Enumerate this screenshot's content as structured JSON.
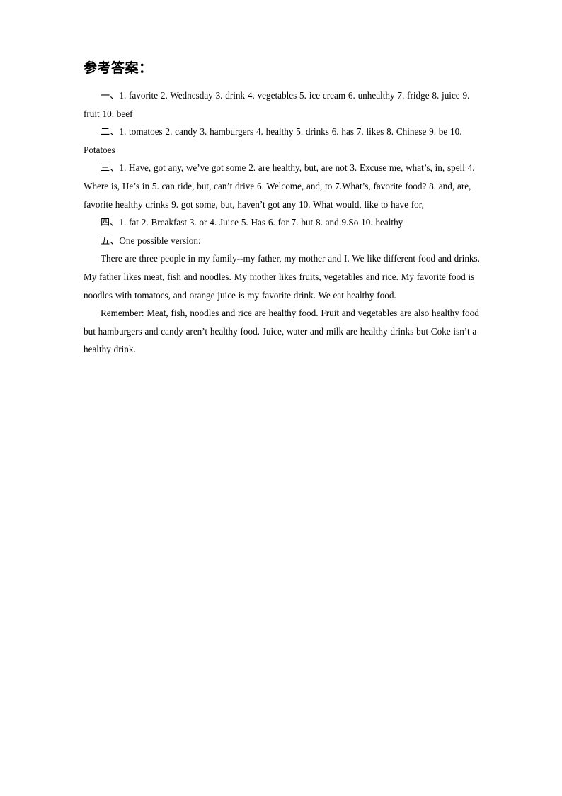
{
  "document": {
    "title": "参考答案：",
    "sections": [
      {
        "id": "section-1",
        "marker": "一、",
        "text": "一、1. favorite   2. Wednesday   3. drink   4. vegetables   5. ice cream   6. unhealthy 7. fridge   8. juice   9. fruit   10. beef"
      },
      {
        "id": "section-2",
        "marker": "二、",
        "text": "二、1. tomatoes   2. candy   3. hamburgers   4. healthy   5. drinks   6. has   7. likes 8. Chinese   9. be   10. Potatoes"
      },
      {
        "id": "section-3",
        "marker": "三、",
        "text": "三、1. Have, got any, we’ve got some   2. are healthy, but, are not   3. Excuse me, what’s, in, spell   4. Where is, He’s in   5. can ride, but, can’t drive   6. Welcome, and, to   7.What’s, favorite food?   8. and, are, favorite healthy drinks   9. got some, but, haven’t got any   10. What would, like to have for,"
      },
      {
        "id": "section-4",
        "marker": "四、",
        "text": "四、1. fat   2. Breakfast   3. or   4. Juice   5. Has   6. for   7. but   8. and   9.So 10. healthy"
      },
      {
        "id": "section-5",
        "marker": "五、",
        "text": "五、One possible version:"
      }
    ],
    "composition": [
      {
        "id": "composition-paragraph-1",
        "text": "There are three people in my family--my father, my mother and I. We like different food and drinks. My father likes meat, fish and noodles. My mother likes fruits, vegetables and rice. My favorite food is noodles with tomatoes, and orange juice is my favorite drink. We eat healthy food."
      },
      {
        "id": "composition-paragraph-2",
        "text": "Remember: Meat, fish, noodles and rice are healthy food. Fruit and vegetables are also healthy food but hamburgers and candy aren’t healthy food. Juice, water and milk are healthy drinks but Coke isn’t a healthy drink."
      }
    ]
  }
}
